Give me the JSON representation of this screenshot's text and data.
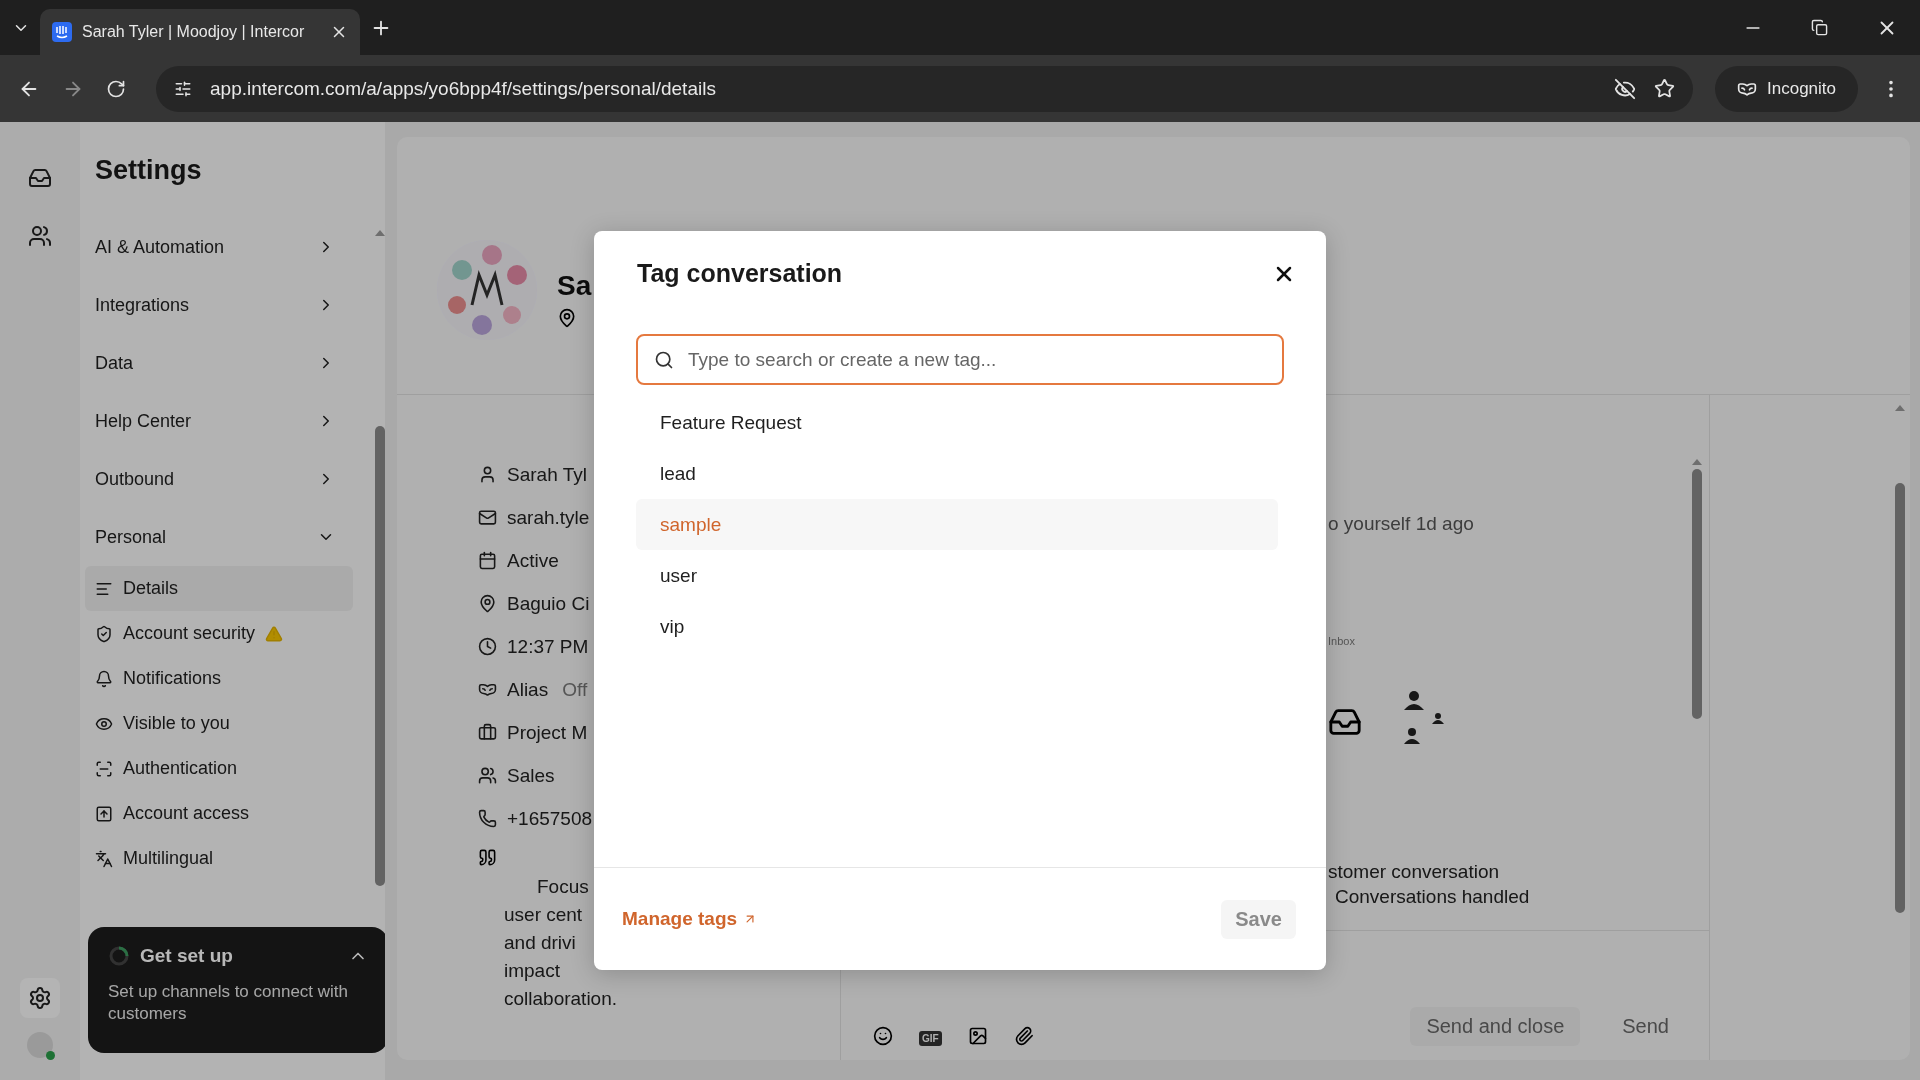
{
  "browser": {
    "tab_title": "Sarah Tyler | Moodjoy | Intercor",
    "url": "app.intercom.com/a/apps/yo6bpp4f/settings/personal/details",
    "profile": "Incognito"
  },
  "sidebar": {
    "title": "Settings",
    "sections": [
      {
        "label": "AI & Automation",
        "expanded": false
      },
      {
        "label": "Integrations",
        "expanded": false
      },
      {
        "label": "Data",
        "expanded": false
      },
      {
        "label": "Help Center",
        "expanded": false
      },
      {
        "label": "Outbound",
        "expanded": false
      },
      {
        "label": "Personal",
        "expanded": true,
        "children": [
          {
            "label": "Details",
            "selected": true,
            "warning": false
          },
          {
            "label": "Account security",
            "selected": false,
            "warning": true
          },
          {
            "label": "Notifications",
            "selected": false,
            "warning": false
          },
          {
            "label": "Visible to you",
            "selected": false,
            "warning": false
          },
          {
            "label": "Authentication",
            "selected": false,
            "warning": false
          },
          {
            "label": "Account access",
            "selected": false,
            "warning": false
          },
          {
            "label": "Multilingual",
            "selected": false,
            "warning": false
          }
        ]
      }
    ]
  },
  "setup_card": {
    "title": "Get set up",
    "text": "Set up channels to connect with customers"
  },
  "profile": {
    "name": "Sa",
    "fields": [
      {
        "text": "Sarah Tyl"
      },
      {
        "text": "sarah.tyle"
      },
      {
        "text": "Active"
      },
      {
        "text": "Baguio Ci"
      },
      {
        "text": "12:37 PM"
      },
      {
        "text": "Alias",
        "value": "Off"
      },
      {
        "text": "Project M"
      },
      {
        "text": "Sales"
      },
      {
        "text": "+1657508"
      }
    ],
    "bio_lines": [
      "Focus",
      "user cent",
      "and drivi",
      "impact",
      "collaboration."
    ]
  },
  "conversation": {
    "activity": "o yourself 1d ago",
    "diagram_label": "Inbox",
    "stat_lines": [
      "stomer conversation",
      "Conversations handled"
    ],
    "gif_label": "GIF",
    "send_close": "Send and close",
    "send": "Send"
  },
  "modal": {
    "title": "Tag conversation",
    "search": {
      "placeholder": "Type to search or create a new tag..."
    },
    "tags": [
      {
        "label": "Feature Request",
        "selected": false
      },
      {
        "label": "lead",
        "selected": false
      },
      {
        "label": "sample",
        "selected": true
      },
      {
        "label": "user",
        "selected": false
      },
      {
        "label": "vip",
        "selected": false
      }
    ],
    "manage_link": "Manage tags",
    "save": "Save"
  }
}
